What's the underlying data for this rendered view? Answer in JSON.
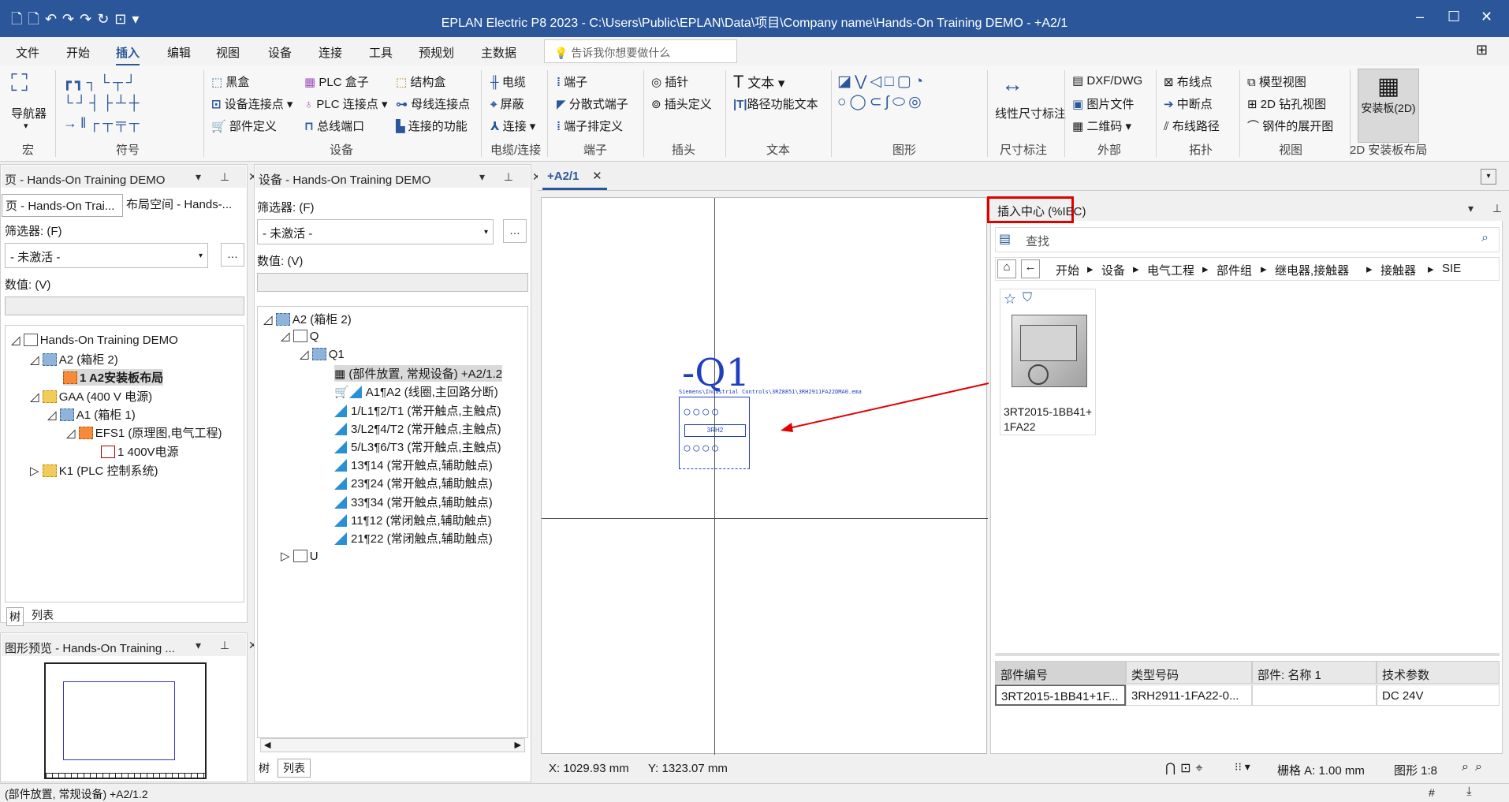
{
  "window": {
    "title": "EPLAN Electric P8 2023 - C:\\Users\\Public\\EPLAN\\Data\\项目\\Company name\\Hands-On Training DEMO - +A2/1",
    "quick_access": "🗋🗋↶↷↷↻⊡▾",
    "min": "–",
    "max": "☐",
    "close": "✕"
  },
  "menu": {
    "items": [
      "文件",
      "开始",
      "插入",
      "编辑",
      "视图",
      "设备",
      "连接",
      "工具",
      "预规划",
      "主数据"
    ],
    "active_index": 2,
    "tell_me": "告诉我你想要做什么"
  },
  "ribbon": {
    "macro": {
      "nav_label": "导航器",
      "group": "宏"
    },
    "symbols": {
      "group": "符号"
    },
    "device": {
      "blackbox": "黑盒",
      "device_conn": "设备连接点",
      "part_def": "部件定义",
      "plc_box": "PLC 盒子",
      "plc_conn": "PLC 连接点",
      "bus_port": "总线端口",
      "struct_box": "结构盒",
      "busbar_conn": "母线连接点",
      "conn_func": "连接的功能",
      "group": "设备"
    },
    "cable": {
      "cable": "电缆",
      "shield": "屏蔽",
      "connect": "连接",
      "group": "电缆/连接"
    },
    "terminal": {
      "terminal": "端子",
      "dist_terminal": "分散式端子",
      "terminal_strip": "端子排定义",
      "group": "端子"
    },
    "plug": {
      "pin": "插针",
      "plug_def": "插头定义",
      "group": "插头"
    },
    "text": {
      "text": "文本",
      "path_func_text": "路径功能文本",
      "group": "文本"
    },
    "graphics": {
      "group": "图形"
    },
    "dimension": {
      "linear": "线性尺寸标注",
      "group": "尺寸标注"
    },
    "external": {
      "dxf": "DXF/DWG",
      "image": "图片文件",
      "qr": "二维码",
      "group": "外部"
    },
    "topology": {
      "wire_point": "布线点",
      "break_point": "中断点",
      "route": "布线路径",
      "group": "拓扑"
    },
    "view": {
      "model": "模型视图",
      "drill": "2D 钻孔视图",
      "unfold": "钢件的展开图",
      "group": "视图"
    },
    "mounting": {
      "btn": "安装板(2D)",
      "group": "2D 安装板布局"
    }
  },
  "pages_panel": {
    "title": "页 - Hands-On Training DEMO",
    "tab1": "页 - Hands-On Trai...",
    "tab2": "布局空间 - Hands-...",
    "filter_label": "筛选器: (F)",
    "filter_value": "- 未激活 -",
    "value_label": "数值: (V)",
    "tree": [
      {
        "label": "Hands-On Training DEMO"
      },
      {
        "label": "A2 (箱柜 2)"
      },
      {
        "label": "1 A2安装板布局"
      },
      {
        "label": "GAA (400 V 电源)"
      },
      {
        "label": "A1 (箱柜 1)"
      },
      {
        "label": "EFS1 (原理图,电气工程)"
      },
      {
        "label": "1 400V电源"
      },
      {
        "label": "K1 (PLC 控制系统)"
      }
    ],
    "bottom_tabs": [
      "树",
      "列表"
    ]
  },
  "preview_panel": {
    "title": "图形预览 - Hands-On Training ..."
  },
  "device_panel": {
    "title": "设备 - Hands-On Training DEMO",
    "filter_label": "筛选器: (F)",
    "filter_value": "- 未激活 -",
    "value_label": "数值: (V)",
    "tree": [
      {
        "label": "A2 (箱柜 2)"
      },
      {
        "label": "Q"
      },
      {
        "label": "Q1"
      },
      {
        "label": "(部件放置, 常规设备) +A2/1.2"
      },
      {
        "label": "A1¶A2 (线圈,主回路分断)"
      },
      {
        "label": "1/L1¶2/T1 (常开触点,主触点)"
      },
      {
        "label": "3/L2¶4/T2 (常开触点,主触点)"
      },
      {
        "label": "5/L3¶6/T3 (常开触点,主触点)"
      },
      {
        "label": "13¶14 (常开触点,辅助触点)"
      },
      {
        "label": "23¶24 (常开触点,辅助触点)"
      },
      {
        "label": "33¶34 (常开触点,辅助触点)"
      },
      {
        "label": "11¶12 (常闭触点,辅助触点)"
      },
      {
        "label": "21¶22 (常闭触点,辅助触点)"
      },
      {
        "label": "U"
      }
    ],
    "bottom_tabs": [
      "树",
      "列表"
    ]
  },
  "document_tab": {
    "label": "+A2/1",
    "close": "✕"
  },
  "canvas": {
    "device_tag": "-Q1",
    "part_path": "Siemens\\Industrial Controls\\3RZ8851\\3RH2911FA22DMA0.ema",
    "inner_label": "3RH2",
    "coords_x": "X: 1029.93 mm",
    "coords_y": "Y: 1323.07 mm",
    "grid": "栅格 A: 1.00 mm",
    "scale": "图形 1:8"
  },
  "insert_center": {
    "title": "插入中心 (%IEC)",
    "search_placeholder": "查找",
    "breadcrumb": [
      "开始",
      "设备",
      "电气工程",
      "部件组",
      "继电器,接触器",
      "接触器",
      "SIE"
    ],
    "item_label": "3RT2015-1BB41+1FA22",
    "table": {
      "headers": [
        "部件编号",
        "类型号码",
        "部件: 名称 1",
        "技术参数"
      ],
      "row": [
        "3RT2015-1BB41+1F...",
        "3RH2911-1FA22-0...",
        "",
        "DC 24V"
      ]
    }
  },
  "statusbar": {
    "left": "(部件放置, 常规设备) +A2/1.2",
    "hash": "#"
  },
  "colors": {
    "accent": "#2b579a",
    "highlight": "#e00000",
    "symbol_blue": "#1f3fbf"
  }
}
